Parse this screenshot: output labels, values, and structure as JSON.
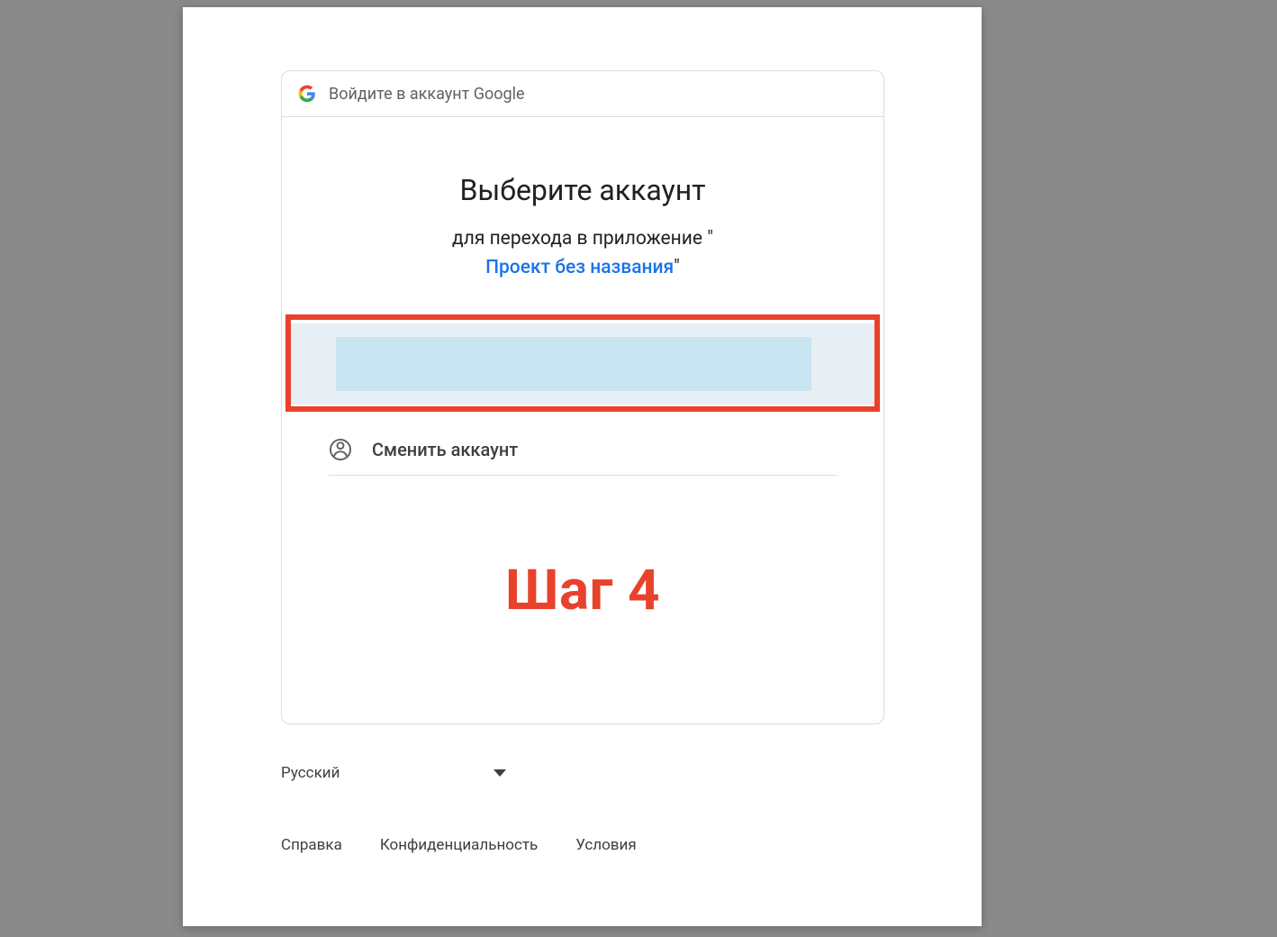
{
  "header": {
    "signin_text": "Войдите в аккаунт Google"
  },
  "title_block": {
    "title": "Выберите аккаунт",
    "subtitle_prefix": "для перехода в приложение \"",
    "app_name": "Проект без названия",
    "subtitle_suffix": "\""
  },
  "switch_account": {
    "label": "Сменить аккаунт"
  },
  "annotation": {
    "step_label": "Шаг 4"
  },
  "language": {
    "selected": "Русский"
  },
  "footer": {
    "help": "Справка",
    "privacy": "Конфиденциальность",
    "terms": "Условия"
  }
}
